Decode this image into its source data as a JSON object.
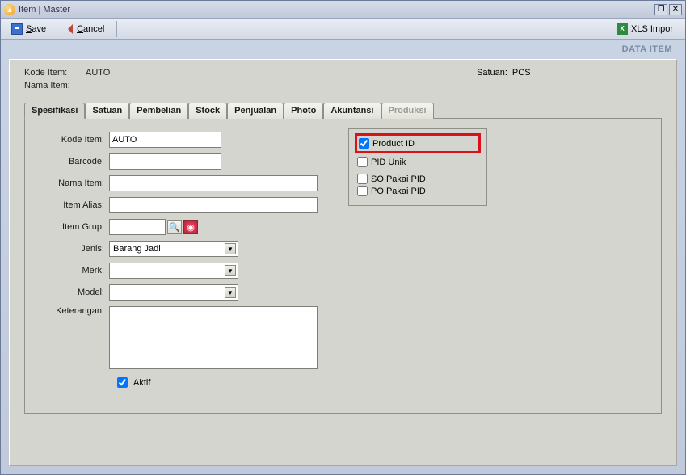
{
  "window": {
    "title": "Item | Master"
  },
  "toolbar": {
    "save_label": "Save",
    "cancel_label": "Cancel",
    "xls_label": "XLS Impor"
  },
  "breadcrumb": "DATA ITEM",
  "header": {
    "kode_label": "Kode Item:",
    "kode_value": "AUTO",
    "nama_label": "Nama Item:",
    "nama_value": "",
    "satuan_label": "Satuan:",
    "satuan_value": "PCS"
  },
  "tabs": [
    {
      "label": "Spesifikasi",
      "active": true
    },
    {
      "label": "Satuan"
    },
    {
      "label": "Pembelian"
    },
    {
      "label": "Stock"
    },
    {
      "label": "Penjualan"
    },
    {
      "label": "Photo"
    },
    {
      "label": "Akuntansi"
    },
    {
      "label": "Produksi",
      "disabled": true
    }
  ],
  "form": {
    "kode_label": "Kode Item:",
    "kode_value": "AUTO",
    "barcode_label": "Barcode:",
    "barcode_value": "",
    "nama_label": "Nama Item:",
    "nama_value": "",
    "alias_label": "Item Alias:",
    "alias_value": "",
    "grup_label": "Item Grup:",
    "grup_value": "",
    "jenis_label": "Jenis:",
    "jenis_value": "Barang Jadi",
    "merk_label": "Merk:",
    "merk_value": "",
    "model_label": "Model:",
    "model_value": "",
    "ket_label": "Keterangan:",
    "ket_value": "",
    "aktif_label": "Aktif",
    "aktif_checked": true
  },
  "pid_panel": {
    "product_id_label": "Product ID",
    "product_id_checked": true,
    "pid_unik_label": "PID Unik",
    "pid_unik_checked": false,
    "so_label": "SO Pakai PID",
    "so_checked": false,
    "po_label": "PO Pakai PID",
    "po_checked": false
  }
}
